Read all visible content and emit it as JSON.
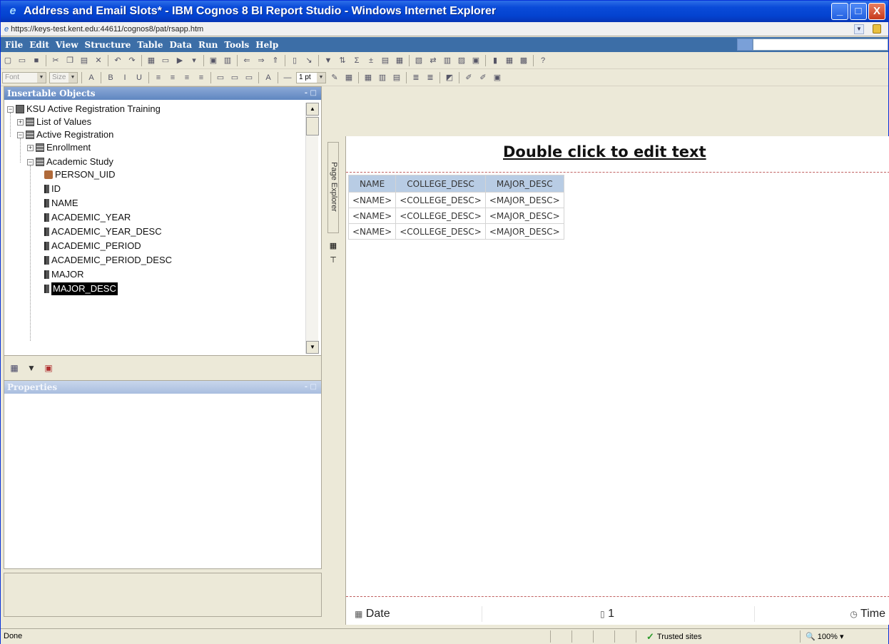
{
  "window": {
    "title": "Address and Email Slots* - IBM Cognos 8 BI Report Studio - Windows Internet Explorer",
    "minimize": "_",
    "maximize": "□",
    "close": "X"
  },
  "address": {
    "url": "https://keys-test.kent.edu:44611/cognos8/pat/rsapp.htm"
  },
  "menu": [
    "File",
    "Edit",
    "View",
    "Structure",
    "Table",
    "Data",
    "Run",
    "Tools",
    "Help"
  ],
  "toolbar2": {
    "font_placeholder": "Font",
    "size_placeholder": "Size",
    "border_width": "1 pt"
  },
  "insertable_panel": {
    "title": "Insertable Objects",
    "tree": [
      {
        "label": "KSU Active Registration Training",
        "icon": "package-icon"
      },
      {
        "label": "List of Values",
        "icon": "query-subject-icon"
      },
      {
        "label": "Active Registration",
        "icon": "query-subject-icon"
      },
      {
        "label": "Enrollment",
        "icon": "query-subject-icon"
      },
      {
        "label": "Academic Study",
        "icon": "query-subject-icon"
      },
      {
        "label": "PERSON_UID",
        "icon": "key-icon"
      },
      {
        "label": "ID",
        "icon": "query-item-icon"
      },
      {
        "label": "NAME",
        "icon": "query-item-icon"
      },
      {
        "label": "ACADEMIC_YEAR",
        "icon": "query-item-icon"
      },
      {
        "label": "ACADEMIC_YEAR_DESC",
        "icon": "query-item-icon"
      },
      {
        "label": "ACADEMIC_PERIOD",
        "icon": "query-item-icon"
      },
      {
        "label": "ACADEMIC_PERIOD_DESC",
        "icon": "query-item-icon"
      },
      {
        "label": "MAJOR",
        "icon": "query-item-icon"
      },
      {
        "label": "MAJOR_DESC",
        "icon": "query-item-icon",
        "selected": true
      }
    ]
  },
  "properties_panel": {
    "title": "Properties"
  },
  "side_tab": {
    "label": "Page Explorer"
  },
  "report": {
    "header_text": "Double click to edit text",
    "columns": [
      "NAME",
      "COLLEGE_DESC",
      "MAJOR_DESC"
    ],
    "rows": [
      [
        "<NAME>",
        "<COLLEGE_DESC>",
        "<MAJOR_DESC>"
      ],
      [
        "<NAME>",
        "<COLLEGE_DESC>",
        "<MAJOR_DESC>"
      ],
      [
        "<NAME>",
        "<COLLEGE_DESC>",
        "<MAJOR_DESC>"
      ]
    ],
    "footer": {
      "date": "Date",
      "page": "1",
      "time": "Time"
    }
  },
  "status": {
    "text": "Done",
    "zone": "Trusted sites",
    "zoom": "100%"
  },
  "colors": {
    "titlebar": "#0443d0",
    "menubar": "#3c6ea7",
    "panel_header": "#6f93c8",
    "table_header": "#b8cce4"
  }
}
